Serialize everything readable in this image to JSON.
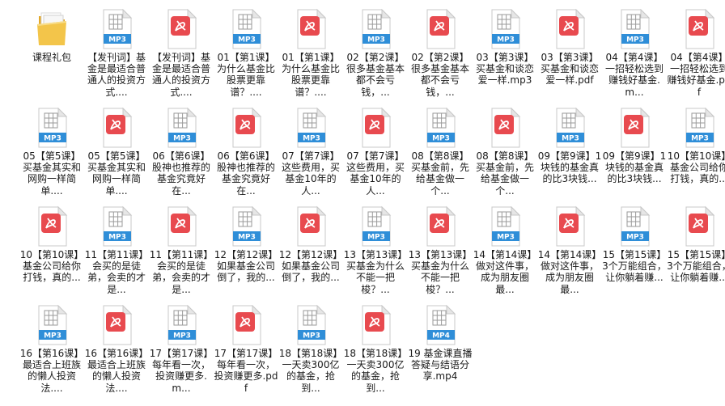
{
  "window": {
    "title": ""
  },
  "items": [
    {
      "type": "folder",
      "label": "课程礼包"
    },
    {
      "type": "mp3",
      "label": "【发刊词】基金是最适合普通人的投资方式...."
    },
    {
      "type": "pdf",
      "label": "【发刊词】基金是最适合普通人的投资方式...."
    },
    {
      "type": "mp3",
      "label": "01【第1课】为什么基金比股票更靠谱？...."
    },
    {
      "type": "pdf",
      "label": "01【第1课】为什么基金比股票更靠谱？...."
    },
    {
      "type": "mp3",
      "label": "02【第2课】很多基金基本都不会亏钱，..."
    },
    {
      "type": "pdf",
      "label": "02【第2课】很多基金基本都不会亏钱，..."
    },
    {
      "type": "mp3",
      "label": "03【第3课】买基金和谈恋爱一样.mp3"
    },
    {
      "type": "pdf",
      "label": "03【第3课】买基金和谈恋爱一样.pdf"
    },
    {
      "type": "mp3",
      "label": "04【第4课】一招轻松选到赚钱好基金.m..."
    },
    {
      "type": "pdf",
      "label": "04【第4课】一招轻松选到赚钱好基金.pdf"
    },
    {
      "type": "mp3",
      "label": "05【第5课】买基金其实和网购一样简单...."
    },
    {
      "type": "pdf",
      "label": "05【第5课】买基金其实和网购一样简单...."
    },
    {
      "type": "mp3",
      "label": "06【第6课】股神也推荐的基金究竟好在..."
    },
    {
      "type": "pdf",
      "label": "06【第6课】股神也推荐的基金究竟好在..."
    },
    {
      "type": "mp3",
      "label": "07【第7课】这些费用，买基金10年的人..."
    },
    {
      "type": "pdf",
      "label": "07【第7课】这些费用，买基金10年的人..."
    },
    {
      "type": "mp3",
      "label": "08【第8课】买基金前，先给基金做一个..."
    },
    {
      "type": "pdf",
      "label": "08【第8课】买基金前，先给基金做一个..."
    },
    {
      "type": "mp3",
      "label": "09【第9课】1块钱的基金真的比3块钱..."
    },
    {
      "type": "pdf",
      "label": "09【第9课】1块钱的基金真的比3块钱..."
    },
    {
      "type": "mp3",
      "label": "10【第10课】基金公司给你打钱，真的..."
    },
    {
      "type": "pdf",
      "label": "10【第10课】基金公司给你打钱，真的..."
    },
    {
      "type": "mp3",
      "label": "11【第11课】会买的是徒弟，会卖的才是..."
    },
    {
      "type": "pdf",
      "label": "11【第11课】会买的是徒弟，会卖的才是..."
    },
    {
      "type": "mp3",
      "label": "12【第12课】如果基金公司倒了，我的..."
    },
    {
      "type": "pdf",
      "label": "12【第12课】如果基金公司倒了，我的..."
    },
    {
      "type": "mp3",
      "label": "13【第13课】买基金为什么不能一把梭？..."
    },
    {
      "type": "pdf",
      "label": "13【第13课】买基金为什么不能一把梭？..."
    },
    {
      "type": "mp3",
      "label": "14【第14课】做对这件事，成为朋友圈最..."
    },
    {
      "type": "pdf",
      "label": "14【第14课】做对这件事，成为朋友圈最..."
    },
    {
      "type": "mp3",
      "label": "15【第15课】3个万能组合，让你躺着赚..."
    },
    {
      "type": "pdf",
      "label": "15【第15课】3个万能组合，让你躺着赚..."
    },
    {
      "type": "mp3",
      "label": "16【第16课】最适合上班族的懒人投资法...."
    },
    {
      "type": "pdf",
      "label": "16【第16课】最适合上班族的懒人投资法...."
    },
    {
      "type": "mp3",
      "label": "17【第17课】每年看一次，投资赚更多.m..."
    },
    {
      "type": "pdf",
      "label": "17【第17课】每年看一次，投资赚更多.pdf"
    },
    {
      "type": "mp3",
      "label": "18【第18课】一天卖300亿的基金，抢到..."
    },
    {
      "type": "pdf",
      "label": "18【第18课】一天卖300亿的基金，抢到..."
    },
    {
      "type": "mp4",
      "label": "19 基金课直播答疑与结语分享.mp4"
    }
  ],
  "icon_text": {
    "mp3": "MP3",
    "mp4": "MP4"
  },
  "colors": {
    "audio_band": "#2f8ed8",
    "pdf_badge": "#e84a4f",
    "folder": "#f3c54a",
    "folder_back": "#e2a92a"
  }
}
